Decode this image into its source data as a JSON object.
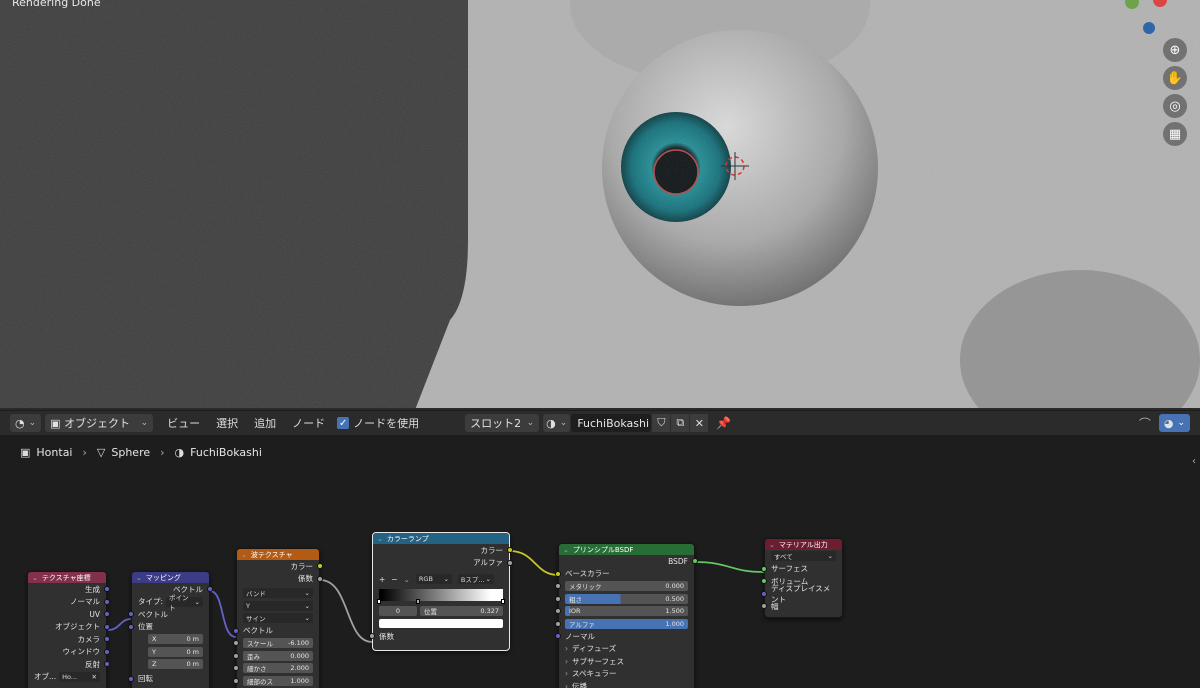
{
  "viewport": {
    "status_text": "Rendering Done"
  },
  "header": {
    "mode_label": "オブジェクト",
    "menus": [
      "ビュー",
      "選択",
      "追加",
      "ノード"
    ],
    "use_nodes_label": "ノードを使用",
    "slot_label": "スロット2",
    "material_name": "FuchiBokashi"
  },
  "breadcrumb": {
    "items": [
      "Hontai",
      "Sphere",
      "FuchiBokashi"
    ]
  },
  "nodes": {
    "texcoord": {
      "title": "テクスチャ座標",
      "outputs": [
        "生成",
        "ノーマル",
        "UV",
        "オブジェクト",
        "カメラ",
        "ウィンドウ",
        "反射"
      ],
      "object_label": "オブ...",
      "object_value": "Ho..."
    },
    "mapping": {
      "title": "マッピング",
      "output": "ベクトル",
      "type_label": "タイプ:",
      "type_value": "ポイント",
      "vector_label": "ベクトル",
      "location_label": "位置",
      "x_label": "X",
      "x_value": "0 m",
      "y_label": "Y",
      "y_value": "0 m",
      "z_label": "Z",
      "z_value": "0 m",
      "rotation_label": "回転"
    },
    "wave": {
      "title": "波テクスチャ",
      "out_color": "カラー",
      "out_fac": "係数",
      "type_value": "バンド",
      "direction_value": "Y",
      "profile_value": "サイン",
      "vector_label": "ベクトル",
      "scale_label": "スケール",
      "scale_value": "-6.100",
      "distortion_label": "歪み",
      "distortion_value": "0.000",
      "detail_label": "細かさ",
      "detail_value": "2.000",
      "detail_scale_label": "細部のス",
      "detail_scale_value": "1.000"
    },
    "colorramp": {
      "title": "カラーランプ",
      "out_color": "カラー",
      "out_alpha": "アルファ",
      "plus": "+",
      "minus": "−",
      "mode_value": "RGB",
      "interp_value": "Bスプ...",
      "index_value": "0",
      "pos_label": "位置",
      "pos_value": "0.327",
      "fac_label": "係数"
    },
    "bsdf": {
      "title": "プリンシプルBSDF",
      "output": "BSDF",
      "base_color_label": "ベースカラー",
      "metallic_label": "メタリック",
      "metallic_value": "0.000",
      "roughness_label": "粗さ",
      "roughness_value": "0.500",
      "ior_label": "IOR",
      "ior_value": "1.500",
      "alpha_label": "アルファ",
      "alpha_value": "1.000",
      "normal_label": "ノーマル",
      "panels": [
        "ディフューズ",
        "サブサーフェス",
        "スペキュラー",
        "伝播"
      ]
    },
    "output": {
      "title": "マテリアル出力",
      "target_value": "すべて",
      "inputs": [
        "サーフェス",
        "ボリューム",
        "ディスプレイスメント",
        "幅"
      ]
    }
  },
  "colors": {
    "texcoord_header": "#83314a",
    "mapping_header": "#3b3b86",
    "wave_header": "#b35b13",
    "colorramp_header": "#246283",
    "bsdf_header": "#286c36",
    "output_header": "#6c1d2f"
  }
}
